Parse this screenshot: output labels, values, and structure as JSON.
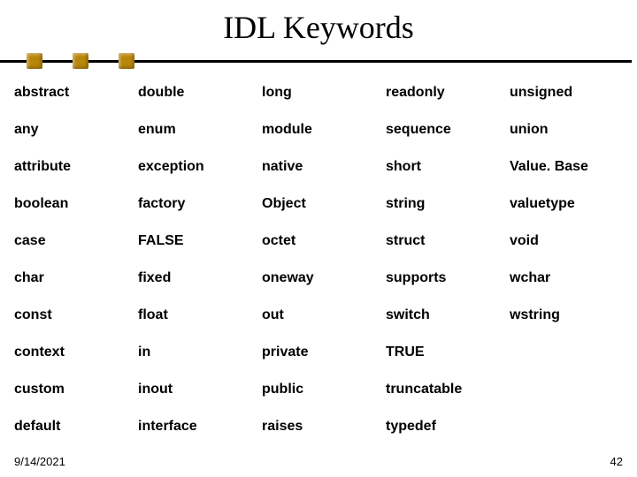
{
  "title": "IDL Keywords",
  "footer": {
    "date": "9/14/2021",
    "page": "42"
  },
  "rows": [
    [
      {
        "t": "abstract",
        "link": false
      },
      {
        "t": "double",
        "link": false
      },
      {
        "t": "long",
        "link": false
      },
      {
        "t": "readonly",
        "link": false
      },
      {
        "t": "unsigned",
        "link": false
      }
    ],
    [
      {
        "t": "any",
        "link": false
      },
      {
        "t": "enum",
        "link": false
      },
      {
        "t": "module",
        "link": true
      },
      {
        "t": "sequence",
        "link": false
      },
      {
        "t": "union",
        "link": false
      }
    ],
    [
      {
        "t": "attribute",
        "link": false
      },
      {
        "t": "exception",
        "link": false
      },
      {
        "t": "native",
        "link": false
      },
      {
        "t": "short",
        "link": false
      },
      {
        "t": "Value. Base",
        "link": false
      }
    ],
    [
      {
        "t": "boolean",
        "link": false
      },
      {
        "t": "factory",
        "link": false
      },
      {
        "t": "Object",
        "link": false
      },
      {
        "t": "string",
        "link": true
      },
      {
        "t": "valuetype",
        "link": false
      }
    ],
    [
      {
        "t": "case",
        "link": false
      },
      {
        "t": "FALSE",
        "link": false
      },
      {
        "t": "octet",
        "link": false
      },
      {
        "t": "struct",
        "link": true
      },
      {
        "t": "void",
        "link": false
      }
    ],
    [
      {
        "t": "char",
        "link": false
      },
      {
        "t": "fixed",
        "link": false
      },
      {
        "t": "oneway",
        "link": true
      },
      {
        "t": "supports",
        "link": false
      },
      {
        "t": "wchar",
        "link": false
      }
    ],
    [
      {
        "t": "const",
        "link": false
      },
      {
        "t": "float",
        "link": false
      },
      {
        "t": "out",
        "link": false
      },
      {
        "t": "switch",
        "link": false
      },
      {
        "t": "wstring",
        "link": false
      }
    ],
    [
      {
        "t": "context",
        "link": false
      },
      {
        "t": "in",
        "link": true
      },
      {
        "t": "private",
        "link": false
      },
      {
        "t": "TRUE",
        "link": false
      },
      {
        "t": "",
        "link": false
      }
    ],
    [
      {
        "t": "custom",
        "link": false
      },
      {
        "t": "inout",
        "link": true
      },
      {
        "t": "public",
        "link": false
      },
      {
        "t": "truncatable",
        "link": false
      },
      {
        "t": "",
        "link": false
      }
    ],
    [
      {
        "t": "default",
        "link": false
      },
      {
        "t": "interface",
        "link": true
      },
      {
        "t": "raises",
        "link": false
      },
      {
        "t": "typedef",
        "link": false
      },
      {
        "t": "",
        "link": false
      }
    ]
  ]
}
